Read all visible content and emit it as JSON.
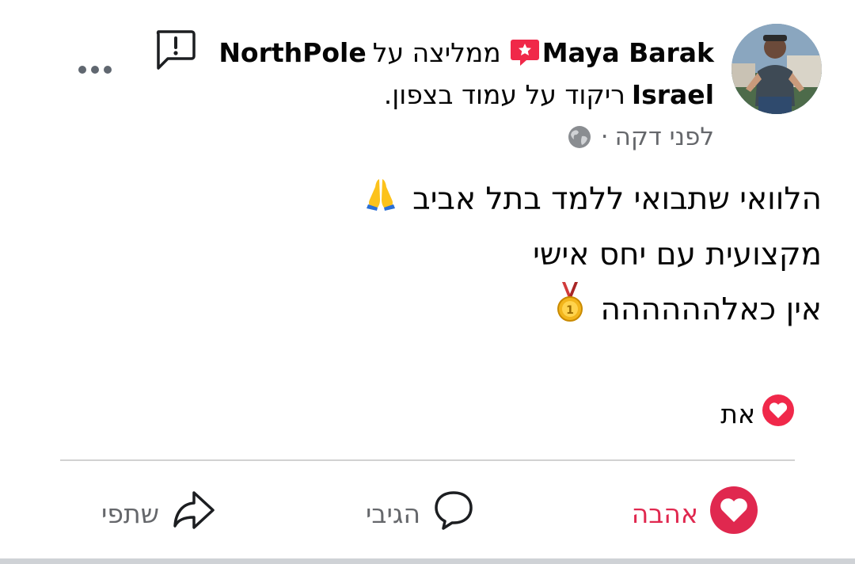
{
  "post": {
    "author": "Maya Barak",
    "recommends_text": "ממליצה על",
    "page_name_part1": "NorthPole",
    "page_name_part2": "Israel",
    "context_text": "ריקוד על עמוד בצפון.",
    "timestamp": "לפני דקה",
    "separator": "·",
    "privacy_icon": "globe-icon",
    "body_lines": [
      "הלוואי שתבואי ללמד בתל אביב",
      "מקצועית עם יחס אישי",
      "אין כאלהההההה"
    ],
    "line1_emoji": "praying-hands-icon",
    "line3_emoji": "medal-icon"
  },
  "reactions": {
    "summary_text": "את",
    "icon": "heart-reaction-icon"
  },
  "actions": {
    "love_label": "אהבה",
    "comment_label": "הגיבי",
    "share_label": "שתפי"
  },
  "colors": {
    "love": "#e0284f",
    "recommend_badge": "#f02849",
    "secondary_text": "#65676b"
  }
}
